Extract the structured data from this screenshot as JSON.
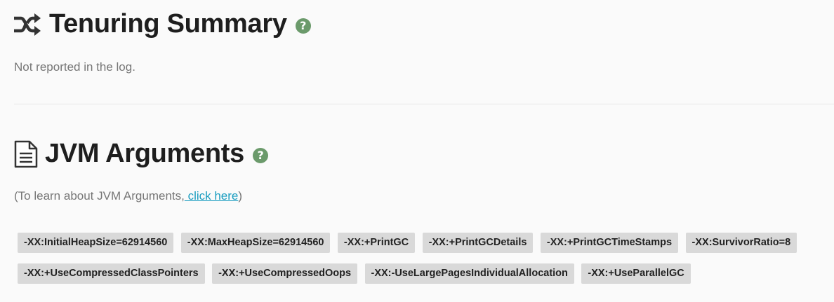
{
  "tenuring": {
    "title": "Tenuring Summary",
    "help_icon": "question-icon",
    "message": "Not reported in the log."
  },
  "jvm": {
    "title": "JVM Arguments",
    "help_icon": "question-icon",
    "learn_prefix": "(To learn about JVM Arguments,",
    "learn_link": " click here",
    "learn_suffix": ")",
    "arguments": [
      "-XX:InitialHeapSize=62914560",
      "-XX:MaxHeapSize=62914560",
      "-XX:+PrintGC",
      "-XX:+PrintGCDetails",
      "-XX:+PrintGCTimeStamps",
      "-XX:SurvivorRatio=8",
      "-XX:+UseCompressedClassPointers",
      "-XX:+UseCompressedOops",
      "-XX:-UseLargePagesIndividualAllocation",
      "-XX:+UseParallelGC"
    ]
  },
  "colors": {
    "help_badge": "#6b9a6b",
    "link": "#1a9dc0",
    "tag_bg": "#d9d9d9"
  }
}
